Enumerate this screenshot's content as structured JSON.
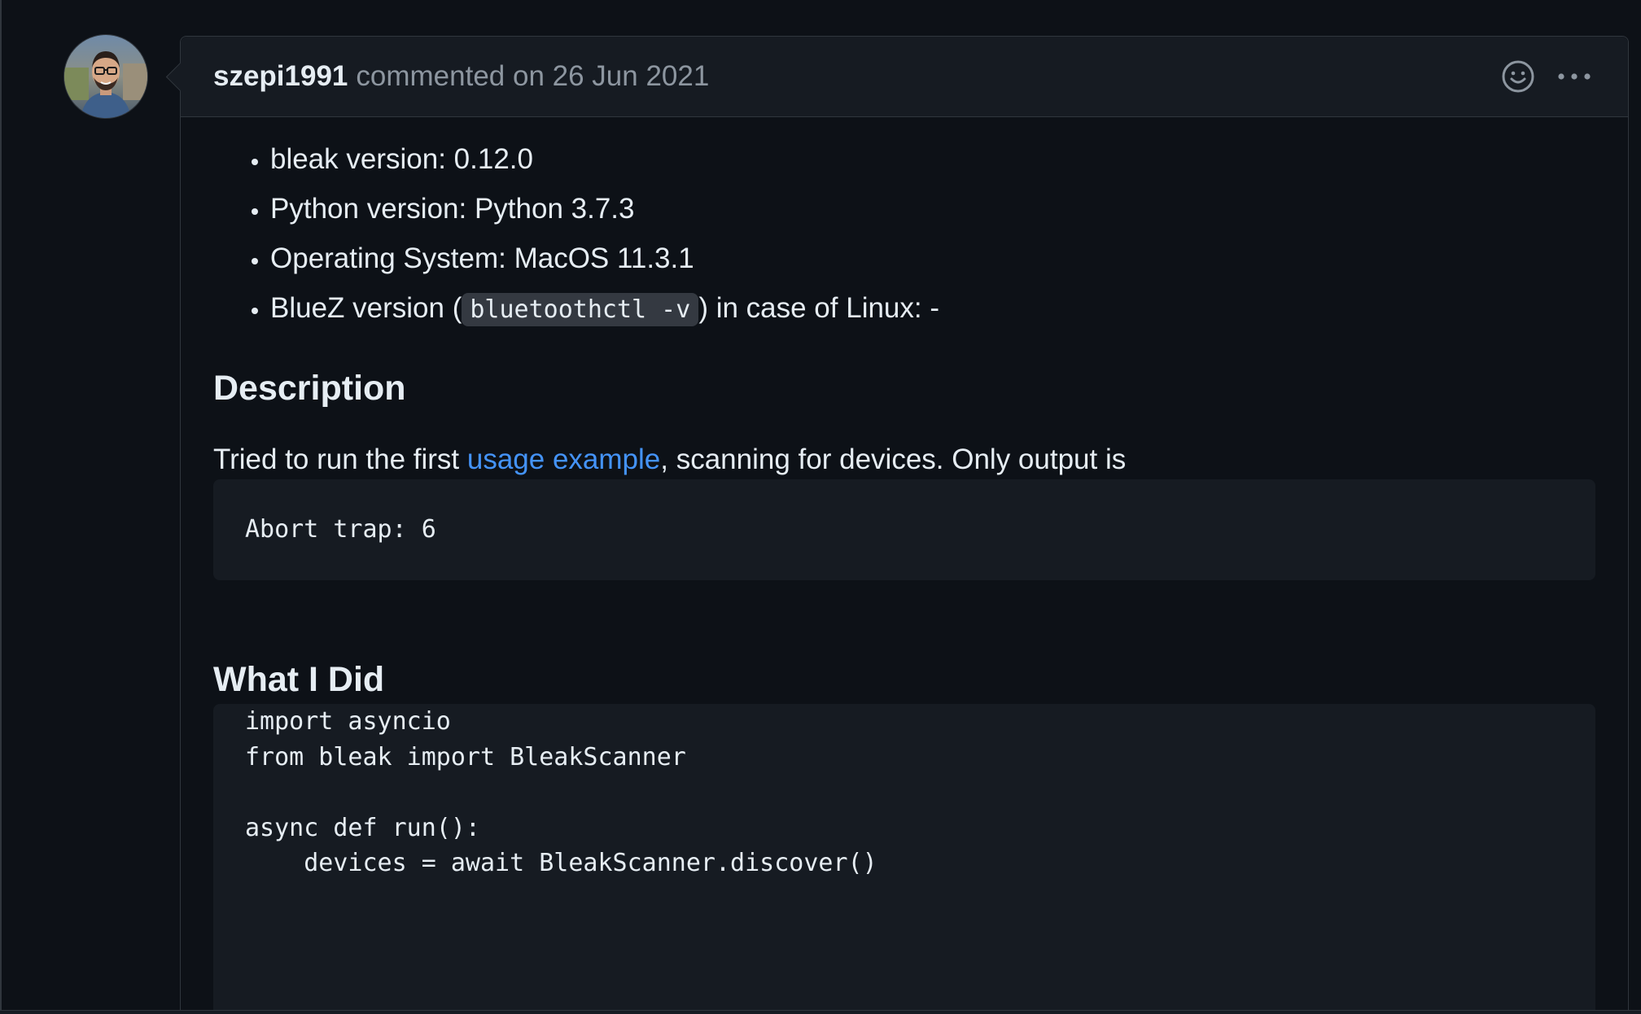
{
  "comment": {
    "author": "szepi1991",
    "meta": "commented on 26 Jun 2021",
    "actions": {
      "reaction_icon": "smiley-icon",
      "menu_icon": "kebab-horizontal-icon"
    },
    "env_list": [
      {
        "text": "bleak version: 0.12.0"
      },
      {
        "text": "Python version: Python 3.7.3"
      },
      {
        "text": "Operating System: MacOS 11.3.1"
      },
      {
        "before": "BlueZ version (",
        "code": "bluetoothctl -v",
        "after": ") in case of Linux: -"
      }
    ],
    "description": {
      "heading": "Description",
      "before": "Tried to run the first ",
      "link": "usage example",
      "after": ", scanning for devices. Only output is",
      "output": "Abort trap: 6"
    },
    "what_i_did": {
      "heading": "What I Did",
      "code_lines": [
        "import asyncio",
        "from bleak import BleakScanner",
        "",
        "async def run():",
        "    devices = await BleakScanner.discover()"
      ]
    }
  },
  "colors": {
    "background": "#0d1117",
    "header_bg": "#161b22",
    "border": "#30363d",
    "text": "#e6edf3",
    "muted": "#8d96a0",
    "link": "#4493f8"
  }
}
